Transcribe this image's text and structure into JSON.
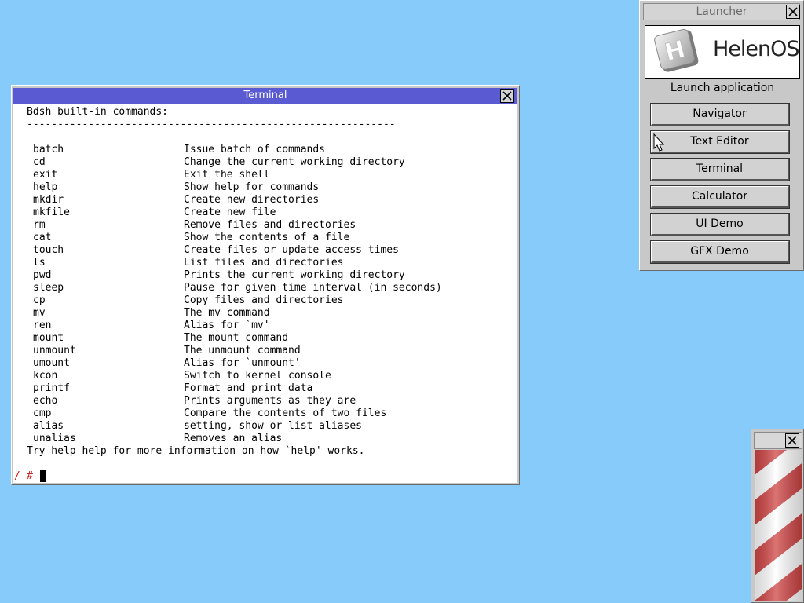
{
  "terminal": {
    "title": "Terminal",
    "header": "Bdsh built-in commands:",
    "separator": "------------------------------------------------------------",
    "commands": [
      {
        "name": "batch",
        "desc": "Issue batch of commands"
      },
      {
        "name": "cd",
        "desc": "Change the current working directory"
      },
      {
        "name": "exit",
        "desc": "Exit the shell"
      },
      {
        "name": "help",
        "desc": "Show help for commands"
      },
      {
        "name": "mkdir",
        "desc": "Create new directories"
      },
      {
        "name": "mkfile",
        "desc": "Create new file"
      },
      {
        "name": "rm",
        "desc": "Remove files and directories"
      },
      {
        "name": "cat",
        "desc": "Show the contents of a file"
      },
      {
        "name": "touch",
        "desc": "Create files or update access times"
      },
      {
        "name": "ls",
        "desc": "List files and directories"
      },
      {
        "name": "pwd",
        "desc": "Prints the current working directory"
      },
      {
        "name": "sleep",
        "desc": "Pause for given time interval (in seconds)"
      },
      {
        "name": "cp",
        "desc": "Copy files and directories"
      },
      {
        "name": "mv",
        "desc": "The mv command"
      },
      {
        "name": "ren",
        "desc": "Alias for `mv'"
      },
      {
        "name": "mount",
        "desc": "The mount command"
      },
      {
        "name": "unmount",
        "desc": "The unmount command"
      },
      {
        "name": "umount",
        "desc": "Alias for `unmount'"
      },
      {
        "name": "kcon",
        "desc": "Switch to kernel console"
      },
      {
        "name": "printf",
        "desc": "Format and print data"
      },
      {
        "name": "echo",
        "desc": "Prints arguments as they are"
      },
      {
        "name": "cmp",
        "desc": "Compare the contents of two files"
      },
      {
        "name": "alias",
        "desc": "setting, show or list aliases"
      },
      {
        "name": "unalias",
        "desc": "Removes an alias"
      }
    ],
    "footer": "Try help help for more information on how `help' works.",
    "prompt_path": "/",
    "prompt_symbol": "#",
    "prompt_color": "#cc2222"
  },
  "launcher": {
    "title": "Launcher",
    "logo_text": "HelenOS",
    "logo_letter": "H",
    "label": "Launch application",
    "buttons": [
      {
        "label": "Navigator"
      },
      {
        "label": "Text Editor"
      },
      {
        "label": "Terminal"
      },
      {
        "label": "Calculator"
      },
      {
        "label": "UI Demo"
      },
      {
        "label": "GFX Demo"
      }
    ]
  },
  "colors": {
    "desktop": "#87cbfb",
    "terminal_titlebar": "#5a5ad2",
    "barber_red": "#d04545",
    "barber_white": "#ffffff"
  },
  "icons": [
    "close-icon",
    "helenos-logo-icon",
    "mouse-pointer-icon",
    "barber-pole-icon"
  ]
}
